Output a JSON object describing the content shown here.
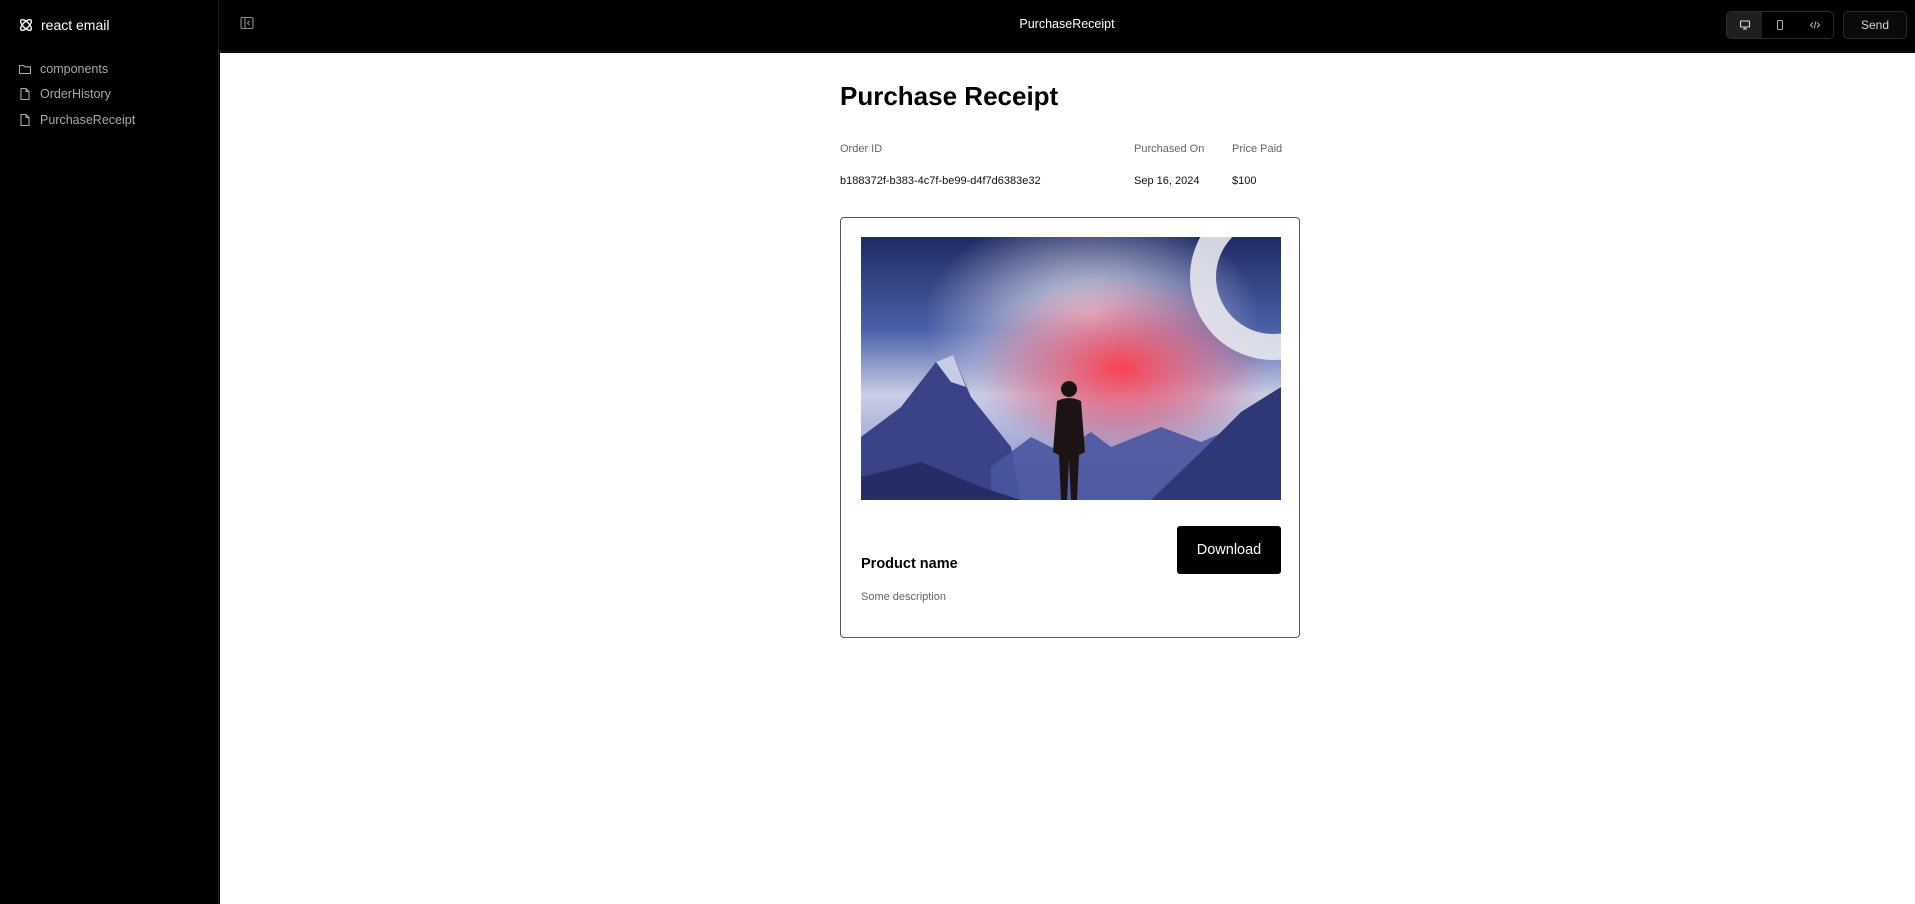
{
  "brand": {
    "name": "react email"
  },
  "sidebar": {
    "items": [
      {
        "label": "components",
        "icon": "folder-icon"
      },
      {
        "label": "OrderHistory",
        "icon": "file-icon"
      },
      {
        "label": "PurchaseReceipt",
        "icon": "file-icon"
      }
    ]
  },
  "topbar": {
    "title": "PurchaseReceipt",
    "view_modes": [
      "desktop-icon",
      "mobile-icon",
      "code-icon"
    ],
    "active_view": "desktop",
    "send_label": "Send"
  },
  "email": {
    "heading": "Purchase Receipt",
    "order_id_label": "Order ID",
    "order_id": "b188372f-b383-4c7f-be99-d4f7d6383e32",
    "purchased_on_label": "Purchased On",
    "purchased_on": "Sep 16, 2024",
    "price_paid_label": "Price Paid",
    "price_paid": "$100",
    "product": {
      "name": "Product name",
      "description": "Some description",
      "download_label": "Download"
    }
  },
  "colors": {
    "chrome_bg": "#000000",
    "preview_bg": "#ffffff",
    "nav_text": "#a8a8a8",
    "button_bg": "#000000"
  }
}
